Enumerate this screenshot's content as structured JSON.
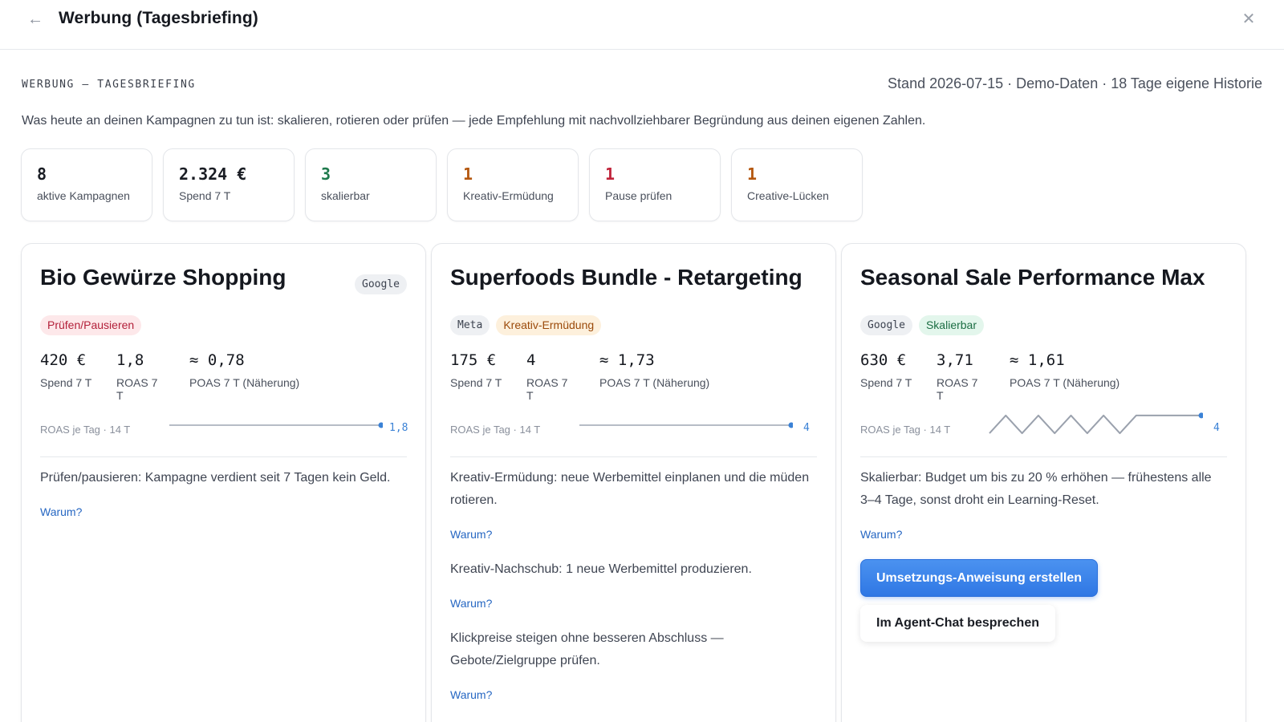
{
  "header": {
    "title": "Werbung (Tagesbriefing)"
  },
  "subheader": {
    "section_label": "WERBUNG — TAGESBRIEFING",
    "status": "Stand 2026-07-15 · Demo-Daten · 18 Tage eigene Historie",
    "intro": "Was heute an deinen Kampagnen zu tun ist: skalieren, rotieren oder prüfen — jede Empfehlung mit nachvollziehbarer Begründung aus deinen eigenen Zahlen."
  },
  "kpis": [
    {
      "value": "8",
      "label": "aktive Kampagnen",
      "color": "#1a1d24"
    },
    {
      "value": "2.324 €",
      "label": "Spend 7 T",
      "color": "#1a1d24"
    },
    {
      "value": "3",
      "label": "skalierbar",
      "color": "#1f7a4d"
    },
    {
      "value": "1",
      "label": "Kreativ-Ermüdung",
      "color": "#b4570f"
    },
    {
      "value": "1",
      "label": "Pause prüfen",
      "color": "#c0233a"
    },
    {
      "value": "1",
      "label": "Creative-Lücken",
      "color": "#b4570f"
    }
  ],
  "cards": [
    {
      "title": "Bio Gewürze Shopping",
      "platform": "Google",
      "status": "Prüfen/Pausieren",
      "status_color": "#b3203a",
      "metrics": [
        {
          "value": "420 €",
          "label": "Spend 7 T"
        },
        {
          "value": "1,8",
          "label": "ROAS 7 T"
        },
        {
          "value": "≈ 0,78",
          "label": "POAS 7 T (Näherung)"
        }
      ],
      "spark_label": "ROAS je Tag · 14 T",
      "spark_value": "1,8",
      "spark_points": [
        1.8,
        1.8,
        1.8,
        1.8,
        1.8,
        1.8,
        1.8,
        1.8,
        1.8,
        1.8,
        1.8,
        1.8,
        1.8,
        1.8
      ],
      "recommendations": [
        {
          "text": "Prüfen/pausieren: Kampagne verdient seit 7 Tagen kein Geld.",
          "why": "Warum?"
        }
      ]
    },
    {
      "title": "Superfoods Bundle - Retargeting",
      "platform": "Meta",
      "status": "Kreativ-Ermüdung",
      "status_color": "#9b4a0a",
      "metrics": [
        {
          "value": "175 €",
          "label": "Spend 7 T"
        },
        {
          "value": "4",
          "label": "ROAS 7 T"
        },
        {
          "value": "≈ 1,73",
          "label": "POAS 7 T (Näherung)"
        }
      ],
      "spark_label": "ROAS je Tag · 14 T",
      "spark_value": "4",
      "spark_points": [
        4,
        4,
        4,
        4,
        4,
        4,
        4,
        4,
        4,
        4,
        4,
        4,
        4,
        4
      ],
      "recommendations": [
        {
          "text": "Kreativ-Ermüdung: neue Werbemittel einplanen und die müden rotieren.",
          "why": "Warum?"
        },
        {
          "text": "Kreativ-Nachschub: 1 neue Werbemittel produzieren.",
          "why": "Warum?"
        },
        {
          "text": "Klickpreise steigen ohne besseren Abschluss — Gebote/Zielgruppe prüfen.",
          "why": "Warum?"
        }
      ]
    },
    {
      "title": "Seasonal Sale Performance Max",
      "platform": "Google",
      "status": "Skalierbar",
      "status_color": "#1c6e44",
      "metrics": [
        {
          "value": "630 €",
          "label": "Spend 7 T"
        },
        {
          "value": "3,71",
          "label": "ROAS 7 T"
        },
        {
          "value": "≈ 1,61",
          "label": "POAS 7 T (Näherung)"
        }
      ],
      "spark_label": "ROAS je Tag · 14 T",
      "spark_value": "4",
      "spark_points": [
        3.2,
        4.1,
        3.2,
        4.1,
        3.2,
        4.1,
        3.2,
        4.1,
        3.2,
        4.1,
        4.1,
        4.1,
        4.1,
        4.1
      ],
      "recommendations": [
        {
          "text": "Skalierbar: Budget um bis zu 20 % erhöhen — frühestens alle 3–4 Tage, sonst droht ein Learning-Reset.",
          "why": "Warum?"
        }
      ],
      "actions": {
        "primary": "Umsetzungs-Anweisung erstellen",
        "secondary": "Im Agent-Chat besprechen"
      }
    }
  ],
  "colors": {
    "accent": "#3b82d6",
    "link": "#2566c2"
  }
}
